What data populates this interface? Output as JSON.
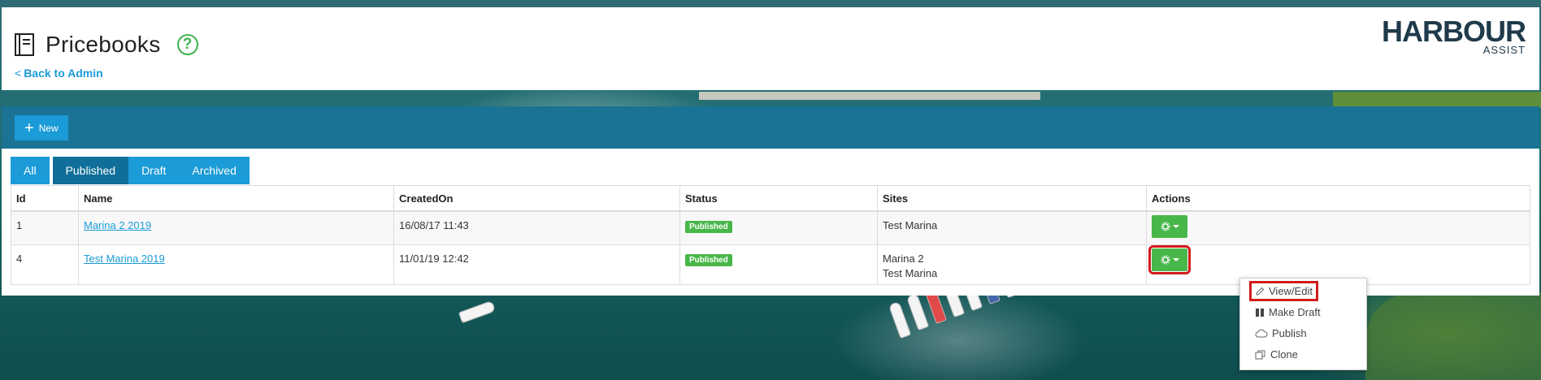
{
  "header": {
    "title": "Pricebooks",
    "back_label": "Back to Admin",
    "logo_main": "HARBOUR",
    "logo_sub": "ASSIST"
  },
  "toolbar": {
    "new_label": "New"
  },
  "tabs": [
    {
      "label": "All"
    },
    {
      "label": "Published",
      "active": true
    },
    {
      "label": "Draft"
    },
    {
      "label": "Archived"
    }
  ],
  "table": {
    "columns": [
      "Id",
      "Name",
      "CreatedOn",
      "Status",
      "Sites",
      "Actions"
    ],
    "rows": [
      {
        "id": "1",
        "name": "Marina 2 2019",
        "created": "16/08/17 11:43",
        "status": "Published",
        "sites": [
          "Test Marina"
        ]
      },
      {
        "id": "4",
        "name": "Test Marina 2019",
        "created": "11/01/19 12:42",
        "status": "Published",
        "sites": [
          "Marina 2",
          "Test Marina"
        ]
      }
    ]
  },
  "menu": {
    "items": [
      {
        "label": "View/Edit",
        "icon": "pencil-icon"
      },
      {
        "label": "Make Draft",
        "icon": "pause-icon"
      },
      {
        "label": "Publish",
        "icon": "cloud-icon"
      },
      {
        "label": "Clone",
        "icon": "clone-icon"
      }
    ]
  },
  "colors": {
    "primary": "#1b9bd7",
    "toolbar": "#1a7395",
    "success": "#48b749",
    "highlight": "#d31a1a"
  }
}
